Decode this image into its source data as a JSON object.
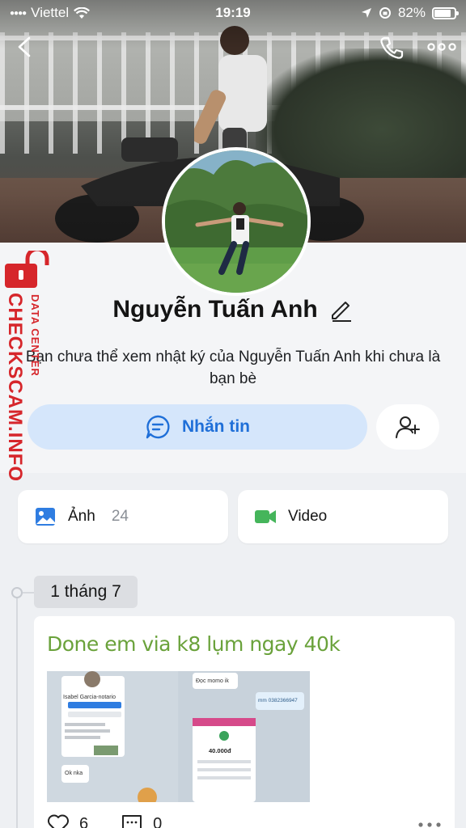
{
  "status_bar": {
    "carrier": "Viettel",
    "time": "19:19",
    "battery": "82%",
    "battery_level": 0.82
  },
  "profile": {
    "name": "Nguyễn Tuấn Anh",
    "notice": "Bạn chưa thể xem nhật ký của Nguyễn Tuấn Anh khi chưa là bạn bè",
    "message_button": "Nhắn tin"
  },
  "watermark": {
    "main": "CHECKSCAM.INFO",
    "sub": "DATA CENTER"
  },
  "tabs": {
    "photos": {
      "label": "Ảnh",
      "count": "24"
    },
    "video": {
      "label": "Video"
    }
  },
  "timeline": {
    "date": "1 tháng 7",
    "post": {
      "text": "Done em via k8 lụm ngay 40k",
      "likes": "6",
      "comments": "0",
      "screenshot_texts": {
        "name": "Isabel Garcia-notario",
        "ok": "Ok nka",
        "doc": "Đọc momo ik",
        "amount": "40.000đ",
        "phone": "mm 0382366947"
      }
    }
  },
  "icons": {
    "back": "back-chevron-icon",
    "call": "phone-icon",
    "more": "more-dots-icon",
    "edit": "pencil-icon",
    "chat": "chat-bubble-icon",
    "add_friend": "add-friend-icon",
    "photo": "image-icon",
    "video": "video-camera-icon",
    "like": "heart-icon",
    "comment": "comment-icon"
  },
  "colors": {
    "accent": "#1f6fd8",
    "button_bg": "#d5e6fb",
    "post_text": "#6aa23b",
    "watermark": "#d6262b",
    "video_icon": "#45b55b"
  }
}
